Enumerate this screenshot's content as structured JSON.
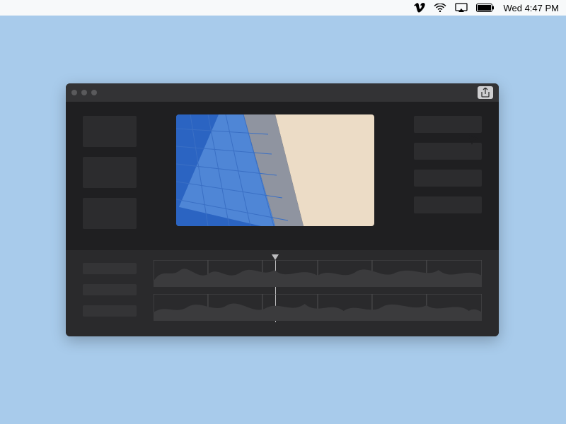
{
  "menubar": {
    "datetime": "Wed 4:47 PM",
    "icons": [
      "vimeo",
      "wifi",
      "airplay",
      "battery"
    ]
  },
  "colors": {
    "desktop": "#a8cbeb",
    "window_bg": "#1f1f21",
    "titlebar": "#333335",
    "panel": "#2c2c2e",
    "timeline_bg": "#2a2a2c"
  },
  "window": {
    "left_panels": [
      "",
      "",
      ""
    ],
    "right_panels": [
      "",
      "",
      "",
      ""
    ],
    "track_labels": [
      "",
      "",
      ""
    ]
  }
}
